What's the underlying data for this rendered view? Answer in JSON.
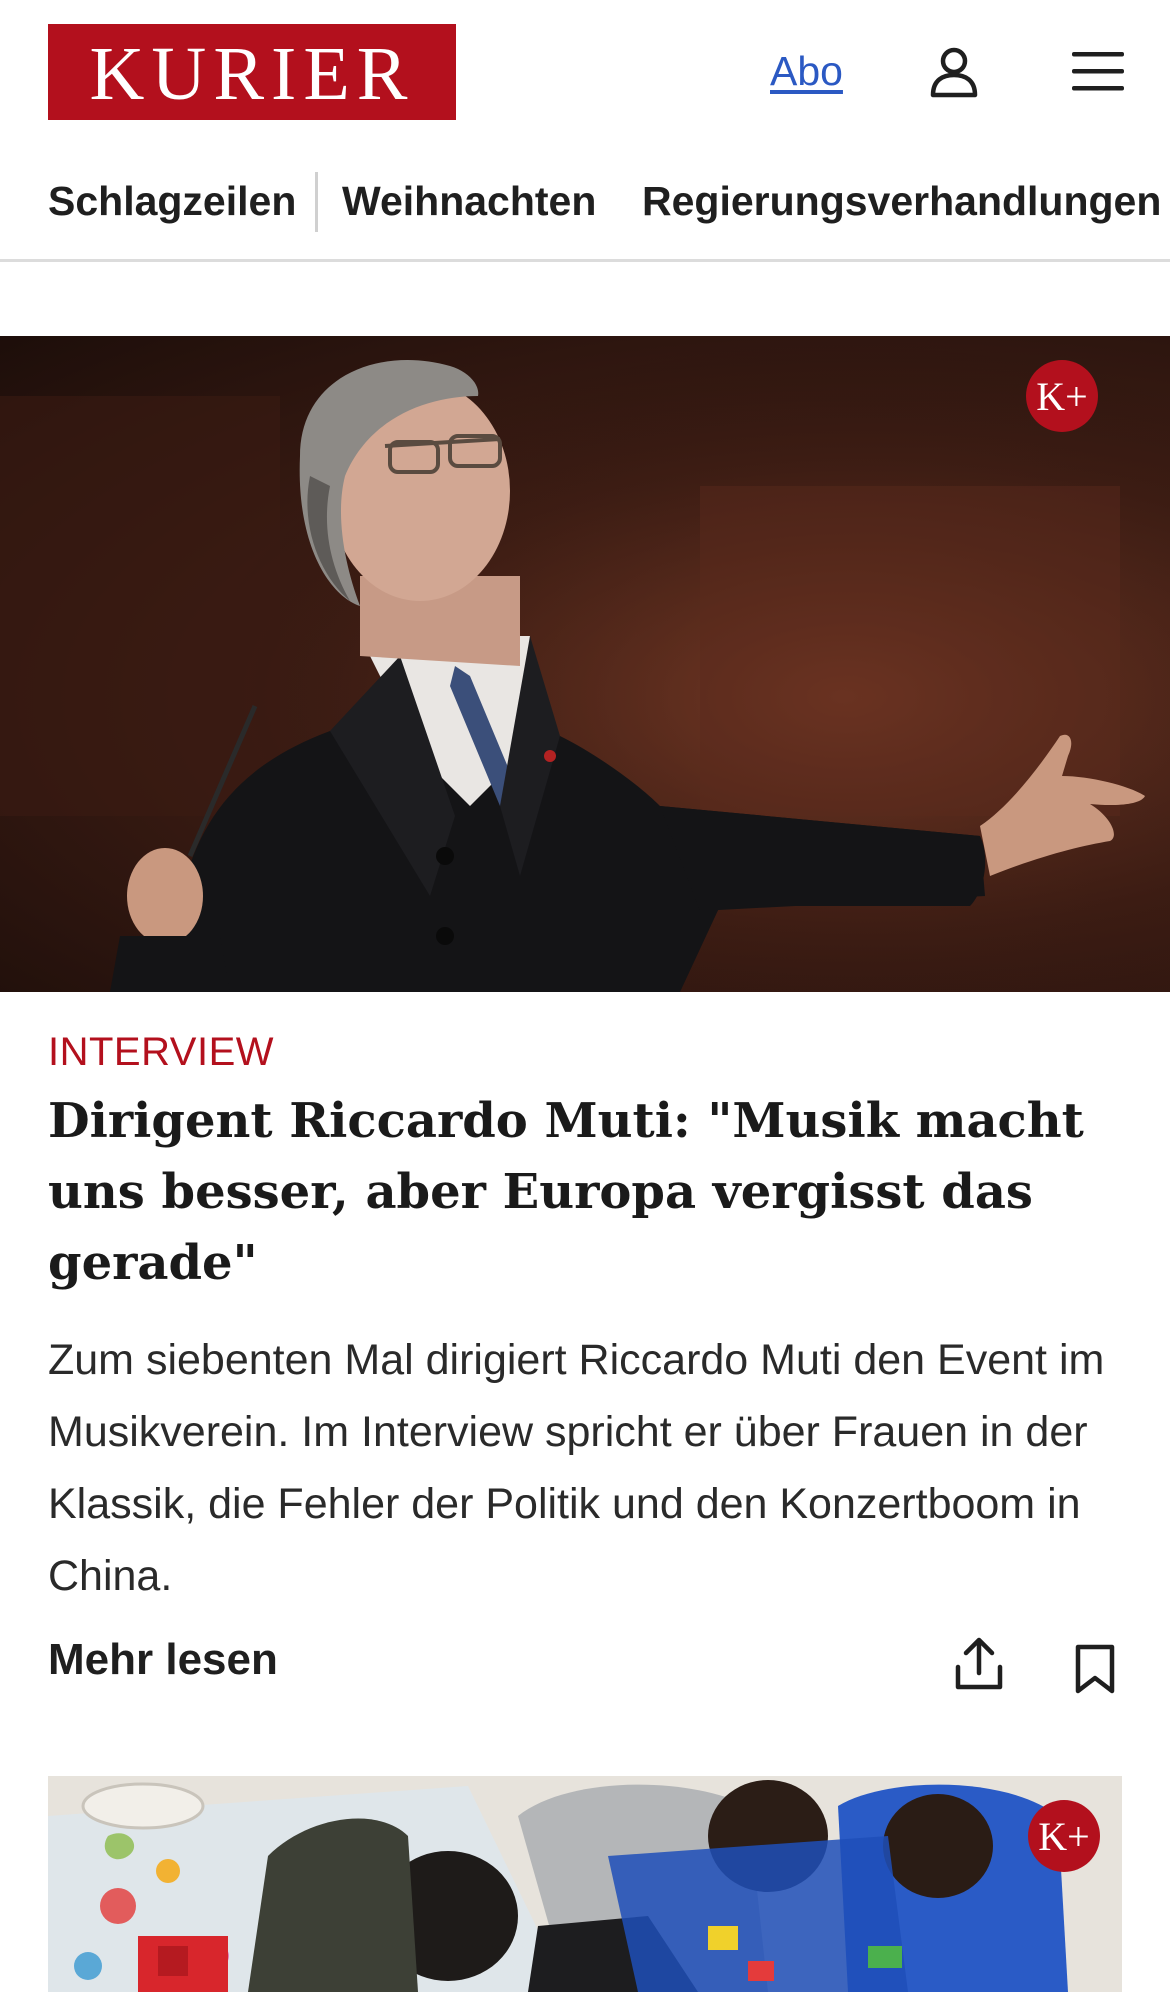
{
  "header": {
    "logo_text": "KURIER",
    "abo_label": "Abo",
    "brand_color": "#b3101d",
    "link_color": "#2b59c3"
  },
  "nav": {
    "items": [
      {
        "label": "Schlagzeilen"
      },
      {
        "label": "Weihnachten"
      },
      {
        "label": "Regierungsverhandlungen"
      }
    ]
  },
  "article": {
    "badge": "K+",
    "kicker": "INTERVIEW",
    "headline": "Dirigent Riccardo Muti: \"Musik macht uns besser, aber Europa vergisst das gerade\"",
    "teaser": "Zum siebenten Mal dirigiert Riccardo Muti den Event im Musikverein. Im Interview spricht er über Frauen in der Klassik, die Fehler der Politik und den Konzertboom in China.",
    "more_label": "Mehr lesen",
    "icons": [
      "share-icon",
      "bookmark-icon"
    ]
  },
  "next_article": {
    "badge": "K+"
  }
}
